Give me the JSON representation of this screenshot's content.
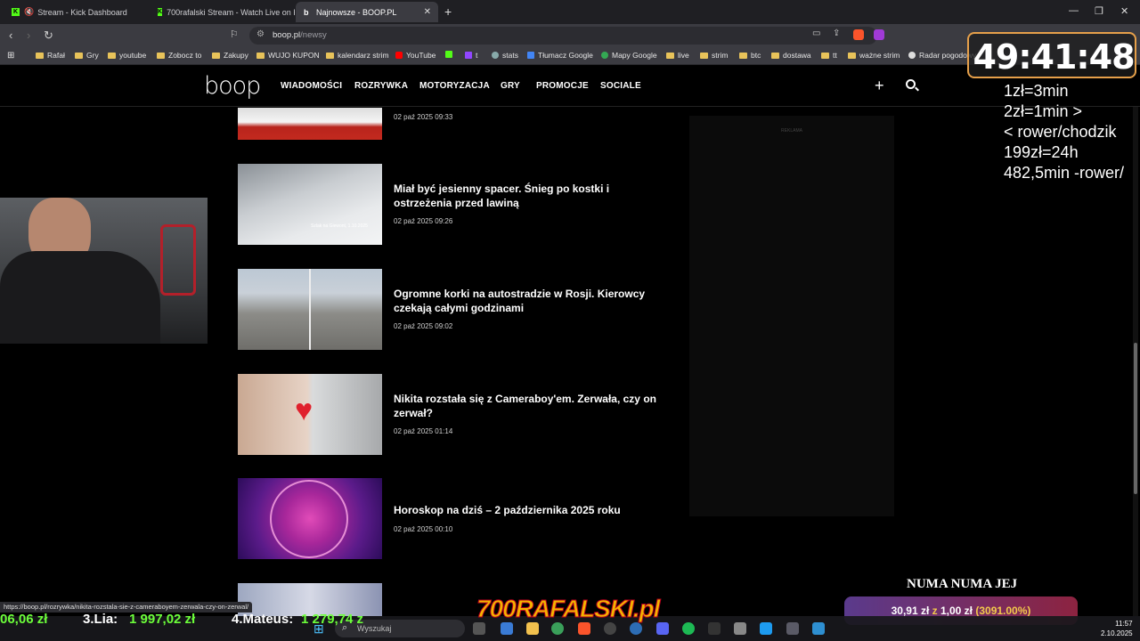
{
  "browser": {
    "tabs": [
      {
        "label": "Stream - Kick Dashboard",
        "icon": "kick-icon"
      },
      {
        "label": "700rafalski Stream - Watch Live on K",
        "icon": "kick-icon"
      },
      {
        "label": "Najnowsze - BOOP.PL",
        "icon": "boop-icon"
      }
    ],
    "url_domain": "boop.pl",
    "url_path": "/newsy",
    "bookmarks": [
      "Rafał",
      "Gry",
      "youtube",
      "Zobocz to",
      "Zakupy",
      "WUJO KUPON",
      "kalendarz strim",
      "YouTube",
      "t",
      "stats",
      "Tłumacz Google",
      "Mapy Google",
      "live",
      "strim",
      "btc",
      "dostawa",
      "tt",
      "ważne strim",
      "Radar pogodowy"
    ]
  },
  "site": {
    "logo": "boop",
    "menu": [
      "WIADOMOŚCI",
      "ROZRYWKA",
      "MOTORYZACJA",
      "GRY",
      "PROMOCJE",
      "SOCIALE"
    ],
    "ad_label": "REKLAMA"
  },
  "articles": [
    {
      "title": "",
      "date": "02 paź 2025 09:33"
    },
    {
      "title": "Miał być jesienny spacer. Śnieg po kostki i ostrzeżenia przed lawiną",
      "date": "02 paź 2025 09:26",
      "thumb_caption": "Szlak na Giewont, 1.10.2025"
    },
    {
      "title": "Ogromne korki na autostradzie w Rosji. Kierowcy czekają całymi godzinami",
      "date": "02 paź 2025 09:02"
    },
    {
      "title": "Nikita rozstała się z Cameraboy'em. Zerwała, czy on zerwał?",
      "date": "02 paź 2025 01:14"
    },
    {
      "title": "Horoskop na dziś – 2 października 2025 roku",
      "date": "02 paź 2025 00:10"
    }
  ],
  "status_url": "https://boop.pl/rozrywka/nikita-rozstala-sie-z-cameraboyem-zerwala-czy-on-zerwal/",
  "overlay": {
    "timer": "49:41:48",
    "rules": [
      "1zł=3min",
      "2zł=1min >",
      "< rower/chodzik",
      "199zł=24h",
      "482,5min -rower/"
    ],
    "song": "NUMA NUMA JEJ",
    "donation_amount": "30,91 zł",
    "donation_sep": "z",
    "donation_goal": "1,00 zł",
    "donation_pct": "(3091.00%)",
    "leaders": [
      "06,06 zł",
      "3.Lia:",
      "1 997,02 zł",
      "4.Mateus:",
      "1 279,74 z"
    ],
    "brand": "700RAFALSKI.pl"
  },
  "taskbar": {
    "search_placeholder": "Wyszukaj",
    "time": "11:57",
    "date": "2.10.2025"
  },
  "colors": {
    "accent_kick": "#53fc18",
    "timer_border": "#e6a04a",
    "donation_pct": "#f2c94c"
  }
}
